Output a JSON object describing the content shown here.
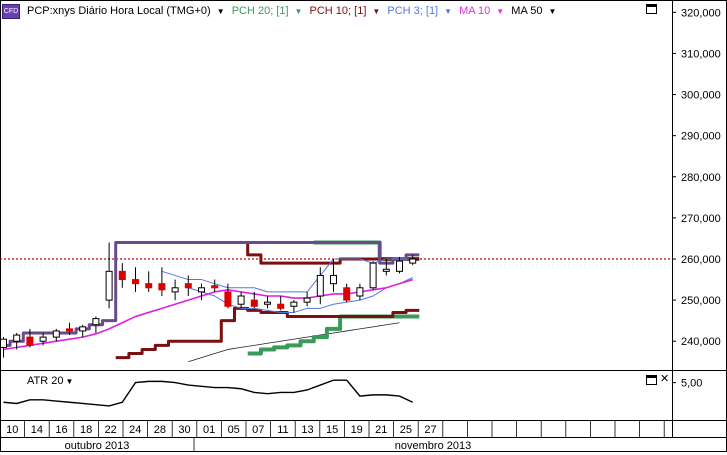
{
  "instrument": {
    "badge": "CFD",
    "title": "PCP:xnys Diário Hora Local (TMG+0)"
  },
  "legend": [
    {
      "label": "PCH 20; [1]",
      "color": "#3a9a5a"
    },
    {
      "label": "PCH 10; [1]",
      "color": "#7a1010"
    },
    {
      "label": "PCH 3; [1]",
      "color": "#5577dd"
    },
    {
      "label": "MA 10",
      "color": "#e030e0"
    },
    {
      "label": "MA 50",
      "color": "#000000"
    }
  ],
  "colors": {
    "pch20": "#3a9a5a",
    "pch10": "#7a1010",
    "pch3": "#5577dd",
    "pch_overlap": "#6a4a8a",
    "ma10": "#e020e0",
    "ma50": "#222222",
    "up_candle": "#ffffff",
    "down_candle": "#dd0000",
    "current_price_line": "#cc0000",
    "atr": "#000000"
  },
  "price_axis": {
    "ticks": [
      "320,000",
      "310,000",
      "300,000",
      "290,000",
      "280,000",
      "270,000",
      "260,000",
      "250,000",
      "240,000"
    ],
    "current_price": 260.0
  },
  "sub_panel": {
    "label": "ATR 20",
    "tick": "5,00"
  },
  "date_axis": {
    "days": [
      "10",
      "14",
      "16",
      "18",
      "22",
      "24",
      "28",
      "30",
      "01",
      "05",
      "07",
      "11",
      "13",
      "15",
      "19",
      "21",
      "25",
      "27"
    ],
    "months": [
      "outubro 2013",
      "novembro 2013"
    ]
  },
  "chart_data": {
    "type": "candlestick",
    "ylim": [
      233,
      323
    ],
    "candles": [
      {
        "o": 238.5,
        "h": 241,
        "l": 236,
        "c": 240.5
      },
      {
        "o": 240,
        "h": 242,
        "l": 238,
        "c": 241.5
      },
      {
        "o": 241,
        "h": 243,
        "l": 238.5,
        "c": 239
      },
      {
        "o": 240,
        "h": 242,
        "l": 239,
        "c": 241
      },
      {
        "o": 241,
        "h": 243,
        "l": 240,
        "c": 242.5
      },
      {
        "o": 243,
        "h": 244.5,
        "l": 241.5,
        "c": 242.5
      },
      {
        "o": 242.5,
        "h": 244,
        "l": 241,
        "c": 243.5
      },
      {
        "o": 244,
        "h": 246,
        "l": 242,
        "c": 245.5
      },
      {
        "o": 250,
        "h": 264,
        "l": 248,
        "c": 257
      },
      {
        "o": 257,
        "h": 259,
        "l": 253,
        "c": 255
      },
      {
        "o": 255,
        "h": 258,
        "l": 252,
        "c": 254
      },
      {
        "o": 254,
        "h": 257,
        "l": 252,
        "c": 253
      },
      {
        "o": 254,
        "h": 258,
        "l": 251,
        "c": 252.5
      },
      {
        "o": 252,
        "h": 255,
        "l": 250,
        "c": 253
      },
      {
        "o": 254,
        "h": 256,
        "l": 251,
        "c": 253
      },
      {
        "o": 252,
        "h": 254,
        "l": 250,
        "c": 253
      },
      {
        "o": 253.5,
        "h": 255,
        "l": 252,
        "c": 253
      },
      {
        "o": 252,
        "h": 254,
        "l": 248,
        "c": 248.5
      },
      {
        "o": 249,
        "h": 252,
        "l": 248,
        "c": 251
      },
      {
        "o": 250,
        "h": 252,
        "l": 248,
        "c": 248.5
      },
      {
        "o": 249,
        "h": 251,
        "l": 248,
        "c": 249.5
      },
      {
        "o": 249,
        "h": 251,
        "l": 247.5,
        "c": 248
      },
      {
        "o": 248.5,
        "h": 250,
        "l": 247,
        "c": 249.5
      },
      {
        "o": 249.5,
        "h": 252,
        "l": 248.5,
        "c": 250.5
      },
      {
        "o": 251,
        "h": 258,
        "l": 249,
        "c": 256
      },
      {
        "o": 254,
        "h": 260,
        "l": 252,
        "c": 256
      },
      {
        "o": 253,
        "h": 254,
        "l": 249.5,
        "c": 250
      },
      {
        "o": 251,
        "h": 254,
        "l": 250,
        "c": 253
      },
      {
        "o": 253,
        "h": 259.5,
        "l": 252.5,
        "c": 259
      },
      {
        "o": 257,
        "h": 260,
        "l": 256,
        "c": 257.5
      },
      {
        "o": 257,
        "h": 260.5,
        "l": 256.5,
        "c": 259.5
      },
      {
        "o": 259,
        "h": 261,
        "l": 258.5,
        "c": 260
      }
    ],
    "pch20_upper": [
      null,
      null,
      null,
      null,
      null,
      null,
      null,
      null,
      null,
      null,
      null,
      null,
      null,
      null,
      null,
      null,
      null,
      null,
      null,
      null,
      null,
      null,
      null,
      null,
      264,
      264,
      264,
      264,
      264,
      260,
      260,
      260
    ],
    "pch20_lower": [
      null,
      null,
      null,
      null,
      null,
      null,
      null,
      null,
      null,
      null,
      null,
      null,
      null,
      null,
      null,
      null,
      null,
      null,
      null,
      237,
      238,
      238.5,
      239,
      240,
      241,
      243,
      246,
      246,
      246,
      246,
      246,
      246
    ],
    "pch10_upper": [
      null,
      null,
      null,
      null,
      null,
      null,
      null,
      null,
      null,
      264,
      264,
      264,
      264,
      264,
      264,
      264,
      264,
      264,
      264,
      261,
      259,
      259,
      259,
      259,
      259,
      259,
      260,
      260,
      260,
      260,
      260,
      260
    ],
    "pch10_lower": [
      null,
      null,
      null,
      null,
      null,
      null,
      null,
      null,
      null,
      236,
      237,
      238,
      239,
      240,
      240,
      240,
      240,
      245,
      248,
      247.5,
      247,
      247,
      246,
      246,
      246,
      246,
      246,
      246,
      246,
      246,
      247,
      247.5
    ],
    "pch3_upper": [
      null,
      null,
      null,
      null,
      null,
      null,
      null,
      null,
      null,
      null,
      null,
      null,
      null,
      null,
      null,
      null,
      null,
      null,
      null,
      null,
      null,
      null,
      null,
      null,
      null,
      null,
      null,
      null,
      null,
      null,
      null,
      null
    ],
    "pch3_lower": [
      null,
      null,
      null,
      null,
      null,
      null,
      null,
      null,
      null,
      null,
      null,
      null,
      null,
      null,
      null,
      null,
      null,
      null,
      null,
      null,
      null,
      null,
      null,
      null,
      null,
      null,
      null,
      null,
      null,
      null,
      null,
      null
    ],
    "pch_mixed_upper": [
      239,
      240,
      242,
      242,
      242,
      242,
      243,
      244,
      245,
      264,
      264,
      264,
      264,
      264,
      264,
      264,
      264,
      264,
      264,
      264,
      264,
      264,
      264,
      264,
      264,
      264,
      264,
      264,
      264,
      259,
      260,
      261
    ],
    "pch3_thin_upper": [
      null,
      null,
      null,
      null,
      null,
      null,
      null,
      null,
      null,
      null,
      null,
      null,
      257,
      256,
      255,
      255,
      254,
      253,
      253,
      253,
      252,
      252,
      252,
      252,
      256,
      260,
      260,
      260,
      259,
      260,
      260,
      260
    ],
    "pch3_thin_lower": [
      null,
      null,
      null,
      null,
      null,
      null,
      null,
      null,
      null,
      null,
      null,
      null,
      null,
      null,
      253,
      252,
      251,
      249,
      248,
      248,
      247.5,
      247,
      247,
      248,
      248,
      249,
      249.5,
      250,
      251,
      253,
      254,
      255.5
    ],
    "ma10": [
      238,
      238.5,
      239,
      239.5,
      240,
      240.5,
      241,
      241.8,
      243,
      244.5,
      246,
      247,
      248,
      249,
      250,
      251,
      252,
      252.5,
      252,
      251.5,
      251,
      251,
      250.5,
      250.5,
      251,
      251.5,
      251.5,
      252,
      252.5,
      253,
      254,
      255
    ],
    "ma50": [
      null,
      null,
      null,
      null,
      null,
      null,
      null,
      null,
      null,
      null,
      null,
      null,
      null,
      null,
      235,
      236,
      237,
      238,
      238.5,
      239,
      239.5,
      240,
      240.5,
      241,
      241.5,
      242,
      242.5,
      243,
      243.5,
      244,
      244.5,
      null
    ],
    "atr20": [
      4.2,
      4.15,
      4.3,
      4.3,
      4.25,
      4.2,
      4.15,
      4.1,
      4.05,
      4.2,
      5.0,
      5.05,
      5.05,
      5.0,
      4.9,
      4.85,
      4.8,
      4.8,
      4.75,
      4.6,
      4.55,
      4.6,
      4.6,
      4.7,
      4.9,
      5.1,
      5.1,
      4.45,
      4.5,
      4.5,
      4.45,
      4.2
    ]
  }
}
